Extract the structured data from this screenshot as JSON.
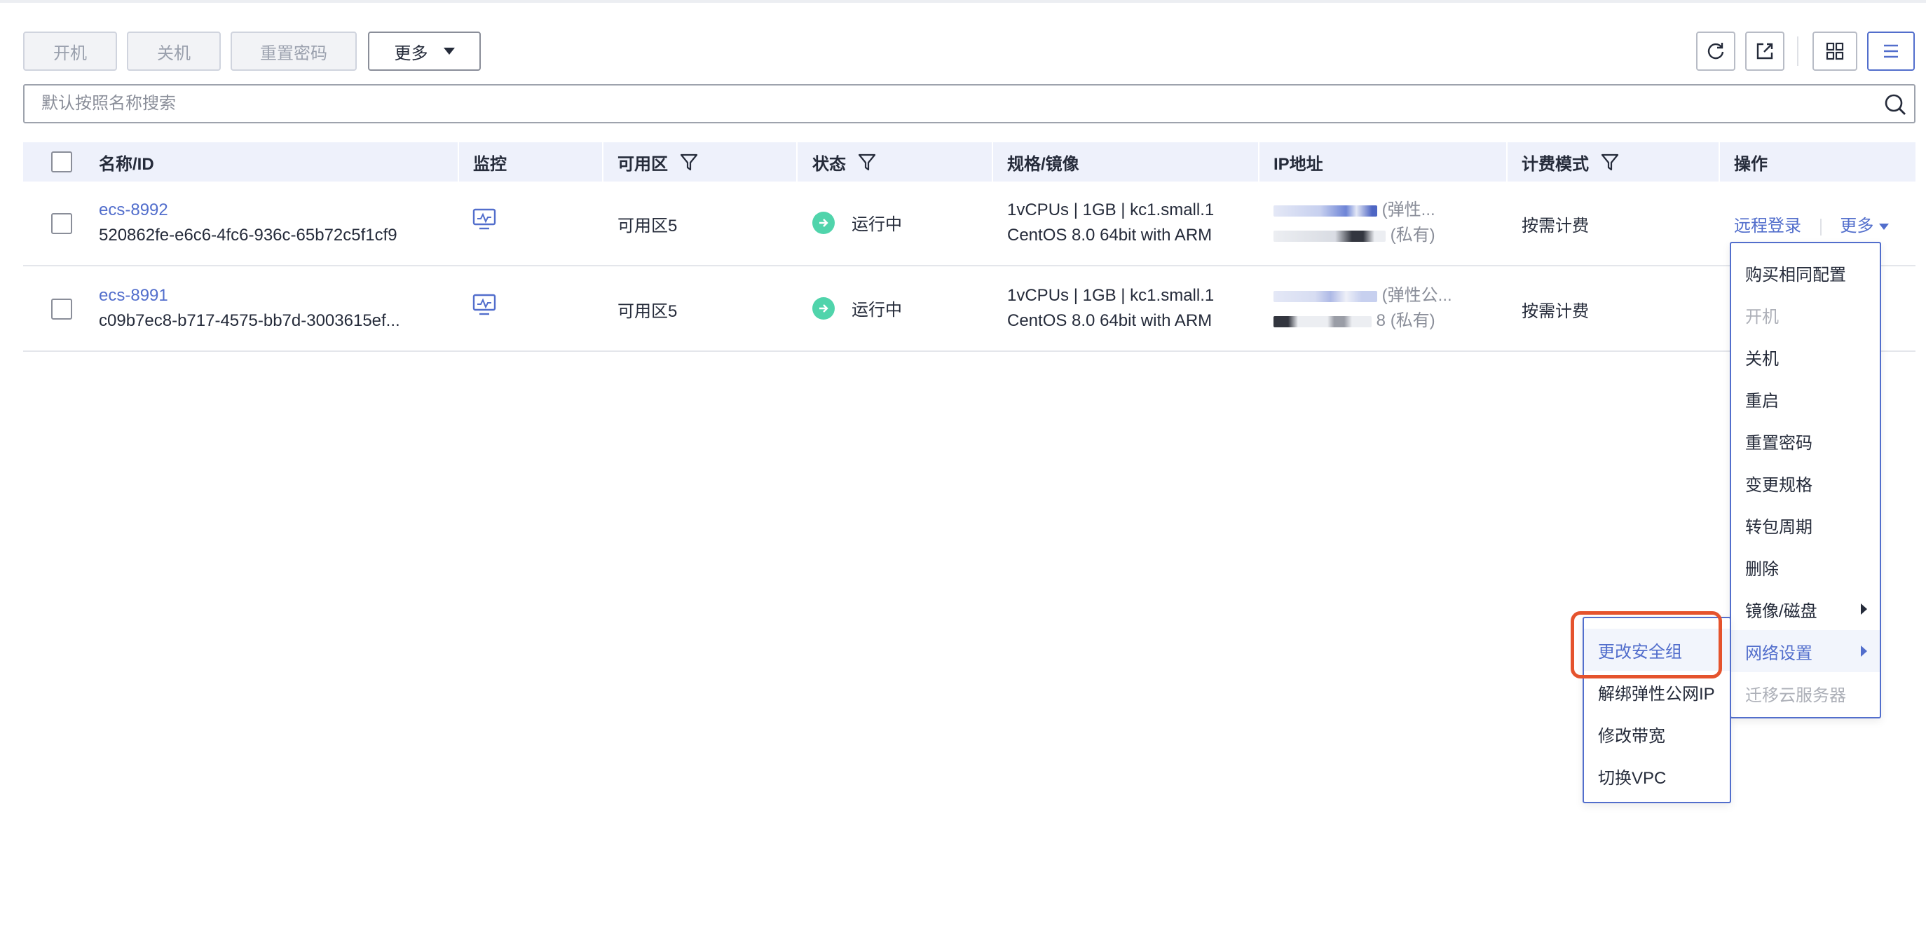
{
  "toolbar": {
    "start_label": "开机",
    "stop_label": "关机",
    "reset_password_label": "重置密码",
    "more_label": "更多",
    "icons": [
      "refresh-icon",
      "export-icon",
      "grid-view-icon",
      "list-view-icon"
    ]
  },
  "search": {
    "placeholder": "默认按照名称搜索"
  },
  "table": {
    "columns": [
      "名称/ID",
      "监控",
      "可用区",
      "状态",
      "规格/镜像",
      "IP地址",
      "计费模式",
      "操作"
    ],
    "rows": [
      {
        "name": "ecs-8992",
        "id": "520862fe-e6c6-4fc6-936c-65b72c5f1cf9",
        "zone": "可用区5",
        "status": "运行中",
        "spec": "1vCPUs | 1GB | kc1.small.1",
        "image": "CentOS 8.0 64bit with ARM",
        "ip_public_suffix": "(弹性...",
        "ip_private_suffix": "(私有)",
        "billing": "按需计费",
        "action_login": "远程登录",
        "action_more": "更多"
      },
      {
        "name": "ecs-8991",
        "id": "c09b7ec8-b717-4575-bb7d-3003615ef...",
        "zone": "可用区5",
        "status": "运行中",
        "spec": "1vCPUs | 1GB | kc1.small.1",
        "image": "CentOS 8.0 64bit with ARM",
        "ip_public_suffix": "(弹性公...",
        "ip_private_suffix": "8 (私有)",
        "billing": "按需计费"
      }
    ]
  },
  "more_menu": {
    "items": [
      "购买相同配置",
      "开机",
      "关机",
      "重启",
      "重置密码",
      "变更规格",
      "转包周期",
      "删除",
      "镜像/磁盘",
      "网络设置",
      "迁移云服务器"
    ]
  },
  "network_submenu": {
    "items": [
      "更改安全组",
      "解绑弹性公网IP",
      "修改带宽",
      "切换VPC"
    ]
  },
  "colors": {
    "accent": "#526ecc",
    "running": "#50d4ab",
    "highlight": "#e5532d",
    "header_bg": "#eef1fb"
  }
}
